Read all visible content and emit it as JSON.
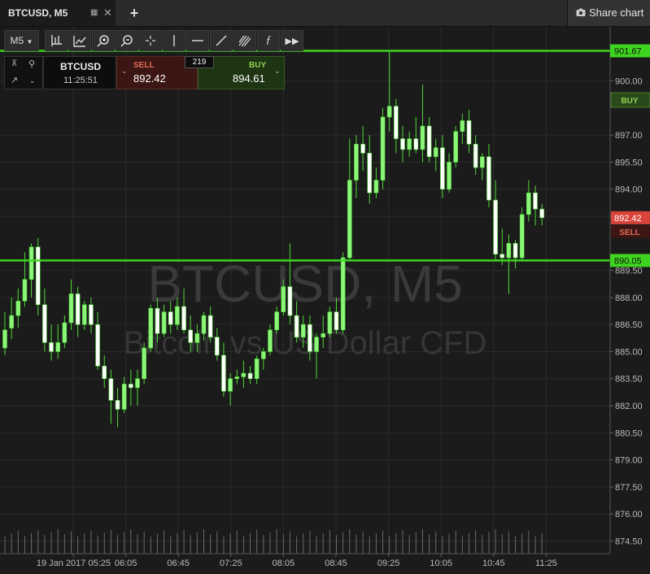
{
  "tab": {
    "title": "BTCUSD, M5"
  },
  "share": {
    "label": "Share chart"
  },
  "toolbar": {
    "timeframe": "M5",
    "tools": [
      "crosshair-bars",
      "trend-indicator",
      "zoom-in",
      "zoom-out",
      "crosshair",
      "vertical-line",
      "horizontal-line",
      "trend-line",
      "fibonacci",
      "function",
      "fast-forward"
    ]
  },
  "panel": {
    "symbol": "BTCUSD",
    "time": "11:25:51",
    "sell_label": "SELL",
    "sell_price": "892.42",
    "spread": "219",
    "buy_label": "BUY",
    "buy_price": "894.61"
  },
  "watermark": {
    "line1": "BTCUSD, M5",
    "line2": "Bitcoin vs US Dollar CFD"
  },
  "price_axis": {
    "ticks": [
      "900.00",
      "897.00",
      "895.50",
      "894.00",
      "892.50",
      "889.50",
      "888.00",
      "886.50",
      "885.00",
      "883.50",
      "882.00",
      "880.50",
      "879.00",
      "877.50",
      "876.00",
      "874.50"
    ],
    "line_labels": [
      "901.67",
      "890.05"
    ],
    "buy_tag": "BUY",
    "sell_price_tag": "892.42",
    "sell_tag": "SELL"
  },
  "time_axis": [
    "19 Jan 2017 05:25",
    "06:05",
    "06:45",
    "07:25",
    "08:05",
    "08:45",
    "09:25",
    "10:05",
    "10:45",
    "11:25"
  ],
  "colors": {
    "bull": "#8cf57a",
    "bear": "#ffffff",
    "hline": "#3ed41f",
    "sell": "#d9443a",
    "buy": "#5a8f2e"
  },
  "chart_data": {
    "type": "candlestick",
    "timeframe": "M5",
    "ylim": [
      873.8,
      903.0
    ],
    "horizontal_lines": [
      901.67,
      890.05
    ],
    "candles": [
      {
        "o": 885.2,
        "h": 887.2,
        "l": 884.8,
        "c": 886.2
      },
      {
        "o": 886.3,
        "h": 888.0,
        "l": 885.7,
        "c": 887.0
      },
      {
        "o": 887.0,
        "h": 888.5,
        "l": 886.3,
        "c": 887.8
      },
      {
        "o": 887.8,
        "h": 890.5,
        "l": 887.5,
        "c": 889.0
      },
      {
        "o": 889.0,
        "h": 891.0,
        "l": 888.0,
        "c": 890.8
      },
      {
        "o": 890.8,
        "h": 891.3,
        "l": 887.0,
        "c": 887.6
      },
      {
        "o": 887.6,
        "h": 888.5,
        "l": 885.0,
        "c": 885.5
      },
      {
        "o": 885.5,
        "h": 886.5,
        "l": 884.5,
        "c": 885.0
      },
      {
        "o": 885.0,
        "h": 886.5,
        "l": 884.6,
        "c": 885.5
      },
      {
        "o": 885.5,
        "h": 887.0,
        "l": 885.2,
        "c": 886.6
      },
      {
        "o": 886.6,
        "h": 889.0,
        "l": 886.2,
        "c": 888.2
      },
      {
        "o": 888.2,
        "h": 888.6,
        "l": 885.8,
        "c": 886.5
      },
      {
        "o": 886.5,
        "h": 887.8,
        "l": 886.2,
        "c": 887.6
      },
      {
        "o": 887.6,
        "h": 888.0,
        "l": 886.0,
        "c": 886.5
      },
      {
        "o": 886.5,
        "h": 887.2,
        "l": 884.0,
        "c": 884.2
      },
      {
        "o": 884.2,
        "h": 884.8,
        "l": 883.0,
        "c": 883.5
      },
      {
        "o": 883.5,
        "h": 884.0,
        "l": 881.0,
        "c": 882.3
      },
      {
        "o": 882.3,
        "h": 883.0,
        "l": 880.8,
        "c": 881.8
      },
      {
        "o": 881.8,
        "h": 883.6,
        "l": 881.6,
        "c": 883.2
      },
      {
        "o": 883.2,
        "h": 884.0,
        "l": 882.0,
        "c": 883.0
      },
      {
        "o": 883.0,
        "h": 884.0,
        "l": 882.0,
        "c": 883.5
      },
      {
        "o": 883.5,
        "h": 885.5,
        "l": 883.2,
        "c": 885.2
      },
      {
        "o": 885.2,
        "h": 887.6,
        "l": 885.0,
        "c": 887.4
      },
      {
        "o": 887.4,
        "h": 888.0,
        "l": 885.5,
        "c": 886.0
      },
      {
        "o": 886.0,
        "h": 887.6,
        "l": 885.8,
        "c": 887.2
      },
      {
        "o": 887.2,
        "h": 887.8,
        "l": 886.0,
        "c": 886.5
      },
      {
        "o": 886.5,
        "h": 888.0,
        "l": 886.2,
        "c": 887.5
      },
      {
        "o": 887.5,
        "h": 888.5,
        "l": 886.0,
        "c": 886.2
      },
      {
        "o": 886.2,
        "h": 887.0,
        "l": 885.0,
        "c": 885.5
      },
      {
        "o": 885.5,
        "h": 886.5,
        "l": 885.0,
        "c": 886.0
      },
      {
        "o": 886.0,
        "h": 887.2,
        "l": 885.6,
        "c": 887.0
      },
      {
        "o": 887.0,
        "h": 887.5,
        "l": 885.5,
        "c": 885.8
      },
      {
        "o": 885.8,
        "h": 886.3,
        "l": 884.5,
        "c": 884.8
      },
      {
        "o": 884.8,
        "h": 885.5,
        "l": 882.5,
        "c": 882.8
      },
      {
        "o": 882.8,
        "h": 883.8,
        "l": 882.0,
        "c": 883.5
      },
      {
        "o": 883.5,
        "h": 884.0,
        "l": 883.2,
        "c": 883.6
      },
      {
        "o": 883.6,
        "h": 884.5,
        "l": 883.0,
        "c": 883.8
      },
      {
        "o": 883.8,
        "h": 884.2,
        "l": 883.2,
        "c": 883.5
      },
      {
        "o": 883.5,
        "h": 884.8,
        "l": 883.2,
        "c": 884.6
      },
      {
        "o": 884.6,
        "h": 885.2,
        "l": 884.0,
        "c": 885.0
      },
      {
        "o": 885.0,
        "h": 886.5,
        "l": 884.8,
        "c": 886.2
      },
      {
        "o": 886.2,
        "h": 887.5,
        "l": 886.0,
        "c": 887.2
      },
      {
        "o": 887.2,
        "h": 889.0,
        "l": 887.0,
        "c": 888.6
      },
      {
        "o": 888.6,
        "h": 891.0,
        "l": 886.5,
        "c": 887.0
      },
      {
        "o": 887.0,
        "h": 887.8,
        "l": 885.5,
        "c": 885.8
      },
      {
        "o": 885.8,
        "h": 887.0,
        "l": 885.2,
        "c": 886.5
      },
      {
        "o": 886.5,
        "h": 887.0,
        "l": 884.5,
        "c": 885.0
      },
      {
        "o": 885.0,
        "h": 886.0,
        "l": 883.5,
        "c": 885.8
      },
      {
        "o": 885.8,
        "h": 887.0,
        "l": 885.2,
        "c": 886.0
      },
      {
        "o": 886.0,
        "h": 887.5,
        "l": 885.8,
        "c": 887.2
      },
      {
        "o": 887.2,
        "h": 888.0,
        "l": 886.0,
        "c": 886.2
      },
      {
        "o": 886.2,
        "h": 890.5,
        "l": 886.0,
        "c": 890.2
      },
      {
        "o": 890.2,
        "h": 896.8,
        "l": 890.0,
        "c": 894.5
      },
      {
        "o": 894.5,
        "h": 897.0,
        "l": 893.5,
        "c": 896.5
      },
      {
        "o": 896.5,
        "h": 897.5,
        "l": 895.0,
        "c": 896.0
      },
      {
        "o": 896.0,
        "h": 897.0,
        "l": 893.2,
        "c": 893.8
      },
      {
        "o": 893.8,
        "h": 895.2,
        "l": 893.5,
        "c": 894.5
      },
      {
        "o": 894.5,
        "h": 898.5,
        "l": 894.0,
        "c": 898.0
      },
      {
        "o": 898.0,
        "h": 901.67,
        "l": 897.2,
        "c": 898.6
      },
      {
        "o": 898.6,
        "h": 899.0,
        "l": 896.0,
        "c": 896.8
      },
      {
        "o": 896.8,
        "h": 897.5,
        "l": 895.5,
        "c": 896.2
      },
      {
        "o": 896.2,
        "h": 897.2,
        "l": 895.8,
        "c": 896.8
      },
      {
        "o": 896.8,
        "h": 898.0,
        "l": 896.0,
        "c": 896.2
      },
      {
        "o": 896.2,
        "h": 899.8,
        "l": 895.5,
        "c": 897.5
      },
      {
        "o": 897.5,
        "h": 898.0,
        "l": 895.5,
        "c": 895.8
      },
      {
        "o": 895.8,
        "h": 896.8,
        "l": 895.0,
        "c": 896.3
      },
      {
        "o": 896.3,
        "h": 897.0,
        "l": 893.5,
        "c": 894.0
      },
      {
        "o": 894.0,
        "h": 896.0,
        "l": 893.8,
        "c": 895.5
      },
      {
        "o": 895.5,
        "h": 897.5,
        "l": 895.2,
        "c": 897.2
      },
      {
        "o": 897.2,
        "h": 898.2,
        "l": 896.5,
        "c": 897.8
      },
      {
        "o": 897.8,
        "h": 898.4,
        "l": 896.0,
        "c": 896.5
      },
      {
        "o": 896.5,
        "h": 897.0,
        "l": 894.8,
        "c": 895.2
      },
      {
        "o": 895.2,
        "h": 896.0,
        "l": 894.5,
        "c": 895.8
      },
      {
        "o": 895.8,
        "h": 896.5,
        "l": 893.0,
        "c": 893.4
      },
      {
        "o": 893.4,
        "h": 894.5,
        "l": 890.0,
        "c": 890.4
      },
      {
        "o": 890.4,
        "h": 891.8,
        "l": 889.8,
        "c": 890.2
      },
      {
        "o": 890.2,
        "h": 891.5,
        "l": 888.2,
        "c": 891.0
      },
      {
        "o": 891.0,
        "h": 891.2,
        "l": 889.6,
        "c": 890.2
      },
      {
        "o": 890.2,
        "h": 893.0,
        "l": 890.0,
        "c": 892.6
      },
      {
        "o": 892.6,
        "h": 894.5,
        "l": 892.2,
        "c": 893.8
      },
      {
        "o": 893.8,
        "h": 894.2,
        "l": 892.0,
        "c": 892.9
      },
      {
        "o": 892.9,
        "h": 893.2,
        "l": 892.0,
        "c": 892.42
      }
    ]
  }
}
